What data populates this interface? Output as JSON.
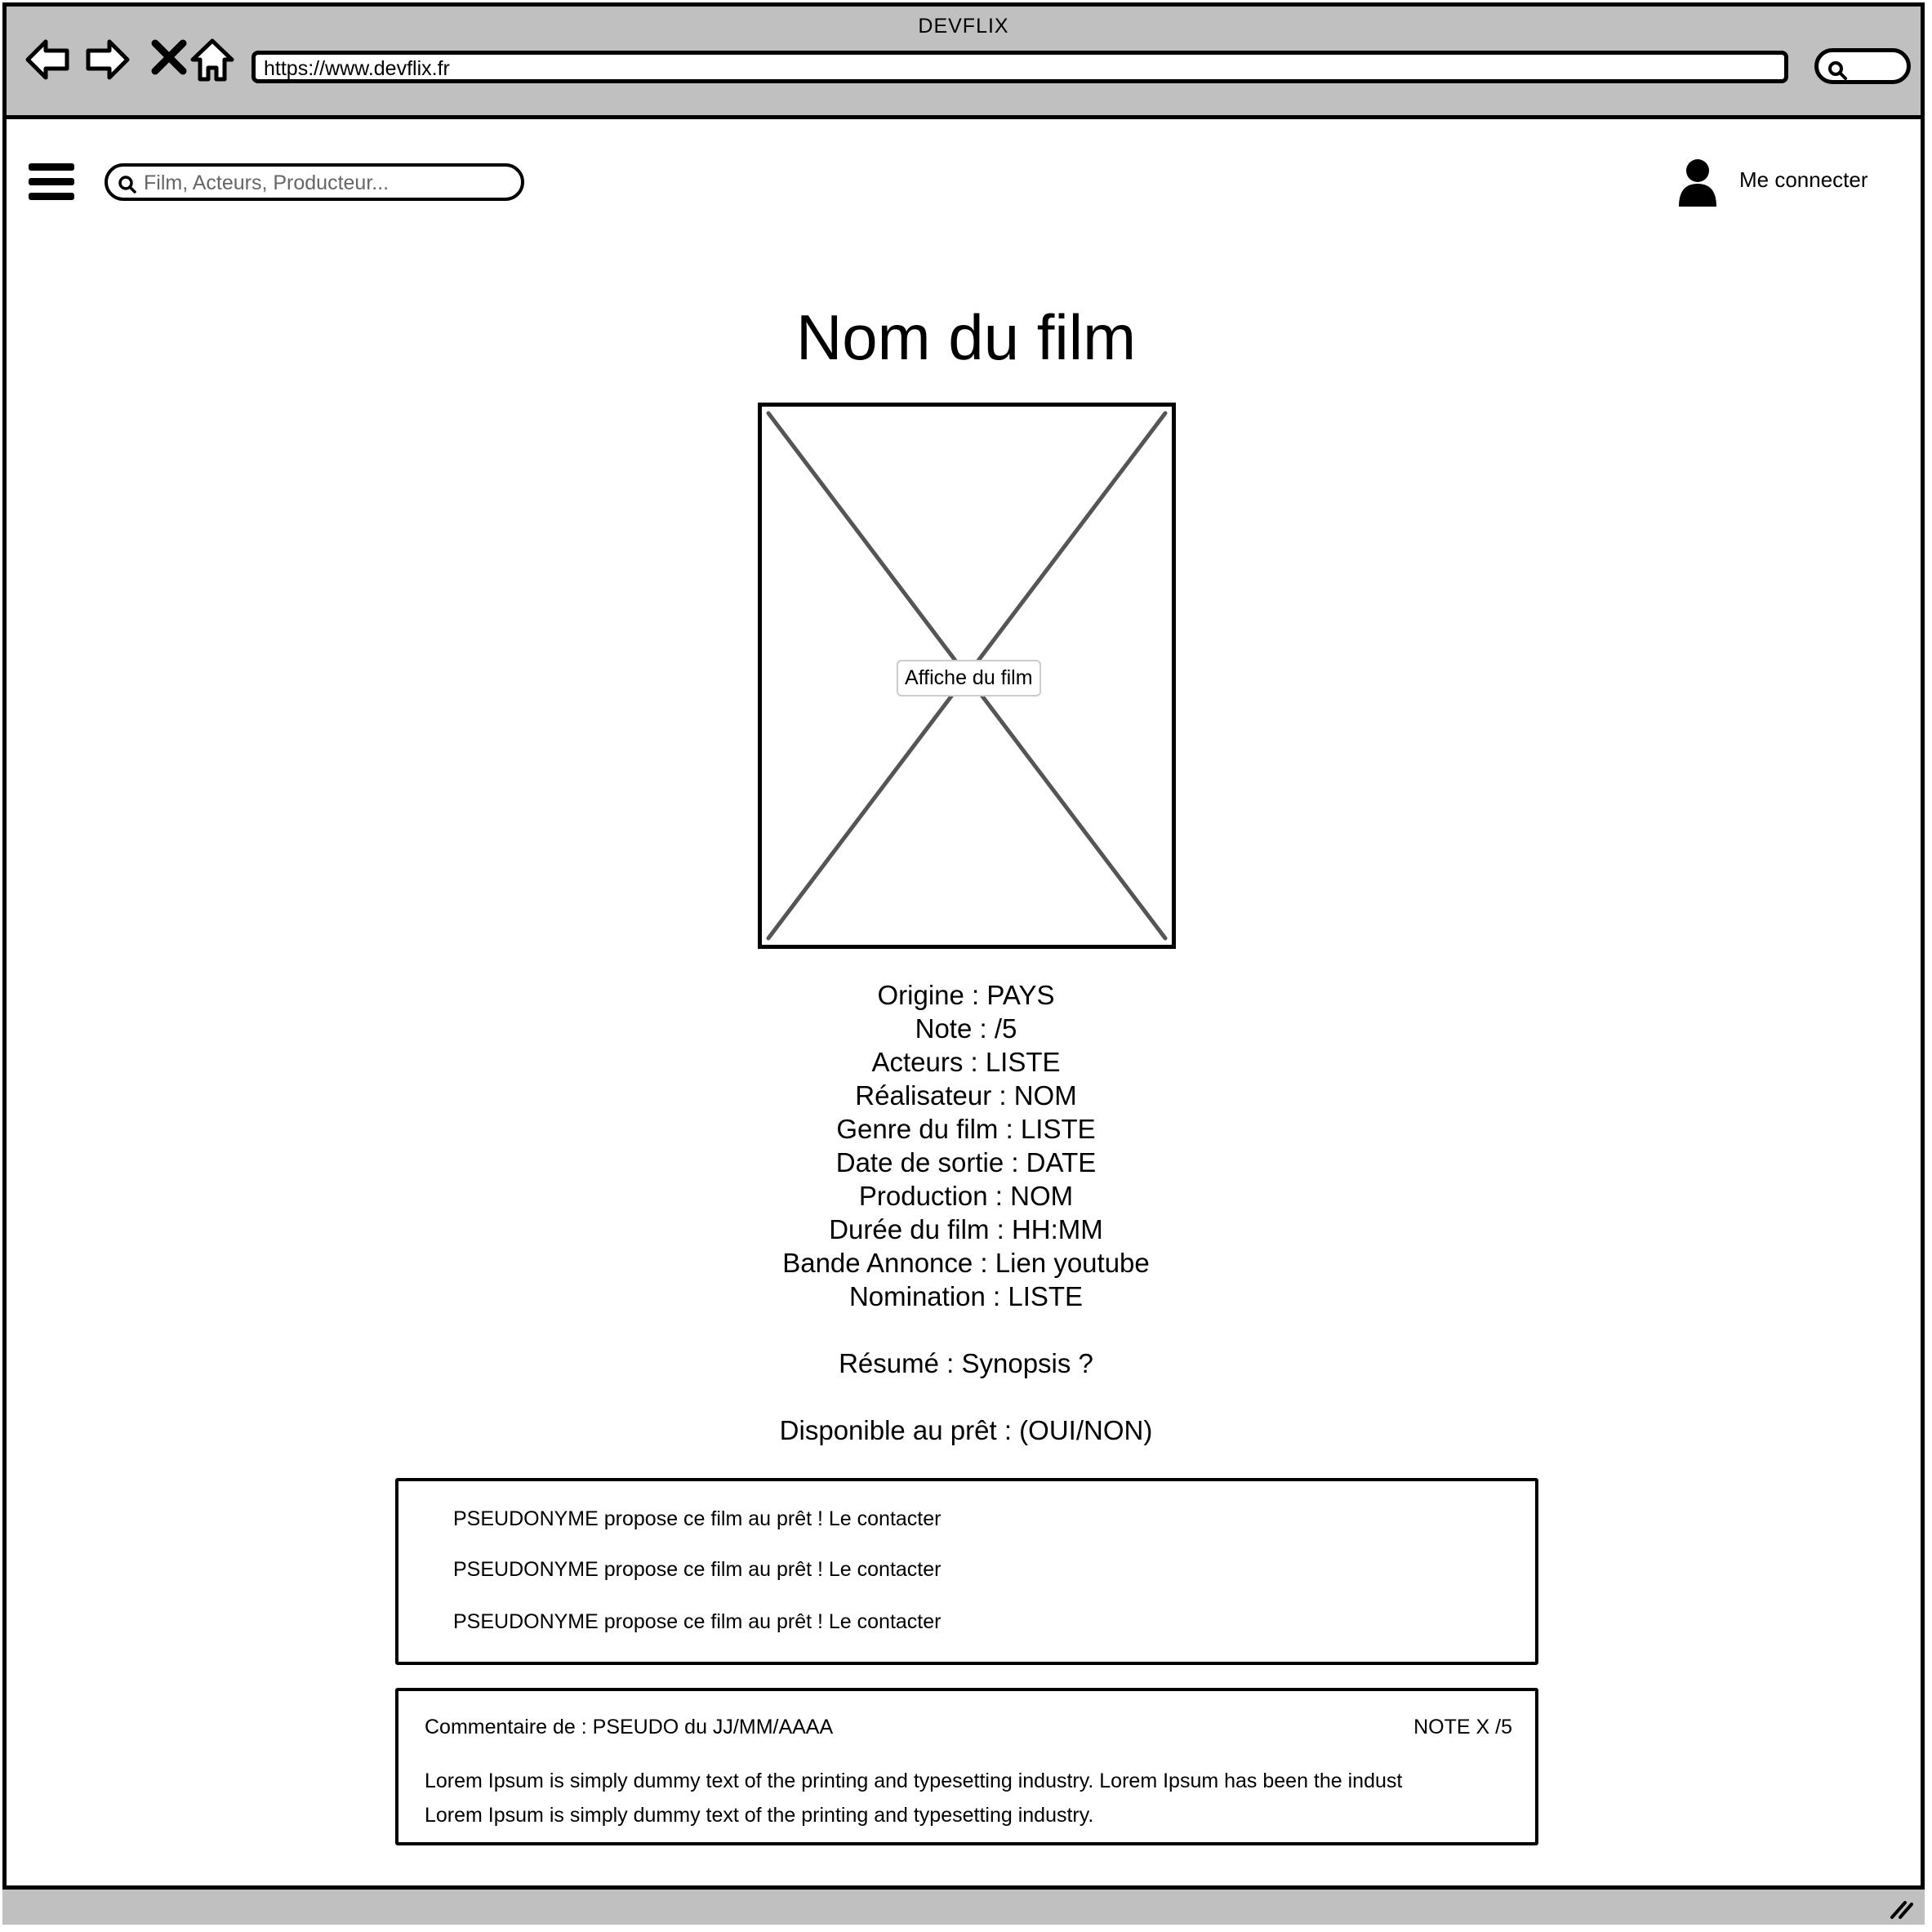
{
  "browser": {
    "window_title": "DEVFLIX",
    "url": "https://www.devflix.fr",
    "nav_icons": [
      "back-arrow-icon",
      "forward-arrow-icon",
      "close-icon",
      "home-icon"
    ]
  },
  "header": {
    "search_placeholder": "Film, Acteurs, Producteur...",
    "login_label": "Me connecter"
  },
  "main": {
    "title": "Nom du film",
    "poster_label": "Affiche du film",
    "info": {
      "origine": "Origine : PAYS",
      "note": "Note :  /5",
      "acteurs": "Acteurs : LISTE",
      "realisateur": "Réalisateur : NOM",
      "genre": "Genre du film : LISTE",
      "date_sortie": "Date de sortie : DATE",
      "production": "Production : NOM",
      "duree": "Durée du film : HH:MM",
      "bande_annonce": "Bande Annonce : Lien youtube",
      "nomination": "Nomination : LISTE",
      "resume": "Résumé : Synopsis ?",
      "disponible": "Disponible au prêt : (OUI/NON)"
    },
    "loans": [
      "PSEUDONYME propose ce film au prêt ! Le contacter",
      "PSEUDONYME propose ce film au prêt ! Le contacter",
      "PSEUDONYME propose ce film au prêt ! Le contacter"
    ],
    "comment": {
      "header": "Commentaire de : PSEUDO du JJ/MM/AAAA",
      "note": "NOTE X /5",
      "line1": "Lorem Ipsum is simply dummy text of the printing and typesetting industry. Lorem Ipsum has been the indust",
      "line2": "Lorem Ipsum is simply dummy text of the printing and typesetting industry."
    }
  },
  "colors": {
    "chrome_gray": "#c0c0c0",
    "ink": "#000000",
    "poster_cross": "#555555"
  }
}
